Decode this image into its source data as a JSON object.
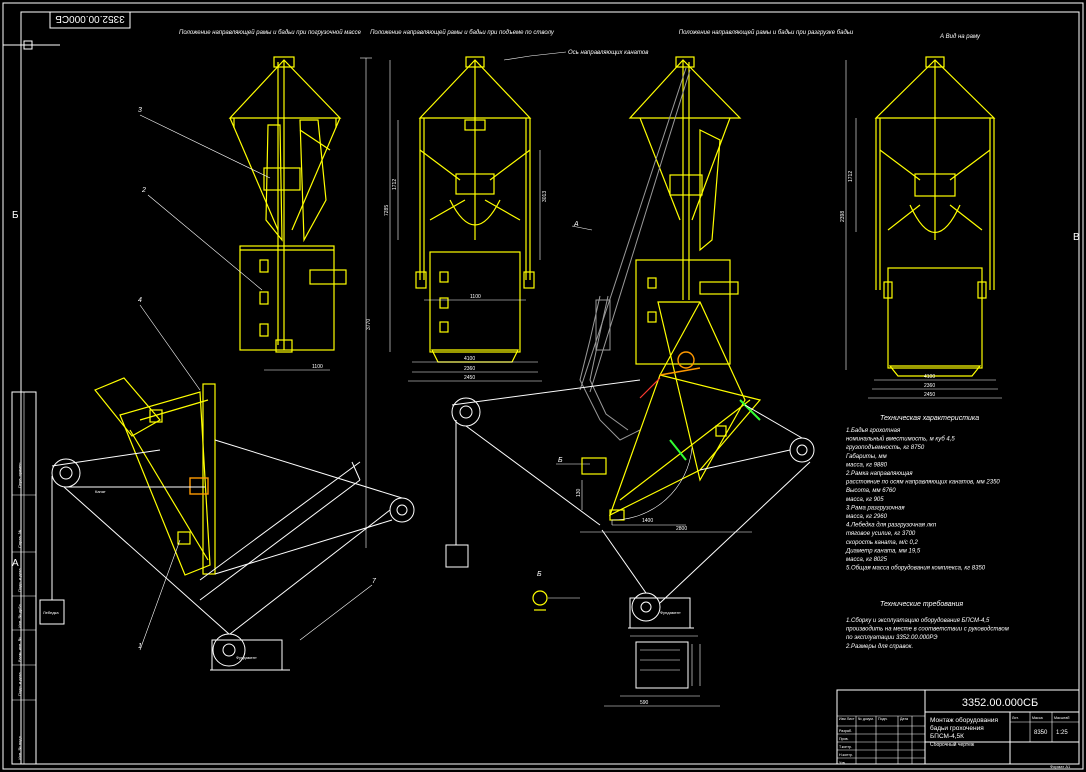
{
  "drawing": {
    "designation": "3352.00.000СБ",
    "designation_rotated": "3352.00.000СБ",
    "title_lines": [
      "Монтаж оборудования",
      "бадьи грохочения",
      "БПСМ-4,5К"
    ],
    "title_subtitle": "Сборочный чертеж",
    "mass": "8350",
    "scale": "1:25",
    "sheet": "Формат А1"
  },
  "zones": {
    "left": "Б",
    "right": "В",
    "lower_left": "А"
  },
  "views": {
    "v1": "Положение направляющей рамы и бадьи при погрузочной массе",
    "v2": "Положение направляющей рамы и бадьи при подъеме по стволу",
    "v3": "Положение направляющей рамы и бадьи при разгрузке бадьи",
    "v4": "А    Вид на раму"
  },
  "callouts": {
    "axis_note": "Ось направляющих канатов",
    "n1": "1",
    "n2": "2",
    "n3": "3",
    "n4": "4",
    "n7": "7",
    "view_a": "А",
    "view_b": "Б",
    "view_b2": "Б"
  },
  "dimensions": {
    "d1": "1100",
    "d2": "1712",
    "d3": "7285",
    "d4": "3013",
    "d5": "4100",
    "d6": "2360",
    "d7": "2450",
    "d8": "1200",
    "d9": "2450",
    "d10": "3770",
    "d11": "1400",
    "d12": "2800",
    "d13": "2398",
    "d14": "4100",
    "d15": "2360",
    "d16": "2450",
    "d17": "1800",
    "d18": "590",
    "d19": "130"
  },
  "specs": {
    "heading": "Техническая характеристика",
    "lines": [
      "1.Бадья грохотная",
      "номинальный вместимость, м куб          4,5",
      "грузоподъемность, кг                    8750",
      "Габариты, мм",
      "масса, кг                               9880",
      "2.Рамка направляющая",
      "расстояние по осям направляющих канатов, мм   2350",
      "Высота, мм                              6760",
      "масса, кг                               905",
      "3.Рама разгрузочная",
      "масса, кг                               2960",
      "4.Лебедка для разгрузочная лкп",
      "тяговое усилие, кг                      3700",
      "скорость каната, м/с                    0,2",
      "Диаметр каната, мм                      19,5",
      "масса, кг                               8025",
      "5.Общая масса оборудования комплекса, кг      8350"
    ]
  },
  "requirements": {
    "heading": "Технические требования",
    "lines": [
      "1.Сборку и эксплуатацию оборудования БПСМ-4,5",
      "производить на месте в соответствии с руководством",
      "по эксплуатации 3352.00.000РЭ",
      "2.Размеры для справок."
    ]
  },
  "title_block_cols": [
    "Изм Лист",
    "№ докум.",
    "Подп.",
    "Дата",
    "Лит.",
    "Масса",
    "Масштаб"
  ],
  "title_block_rows": [
    "Разраб.",
    "Пров.",
    "Т.контр.",
    "Н.контр.",
    "Утв."
  ],
  "left_strip": [
    "Перв. примен.",
    "Справ. №",
    "Подп. и дата",
    "Инв. № дубл.",
    "Взам. инв. №",
    "Подп. и дата",
    "Инв. № подл."
  ],
  "small_labels": {
    "winch": "Лебедка",
    "rope": "Канат",
    "fix": "Фундамент"
  }
}
